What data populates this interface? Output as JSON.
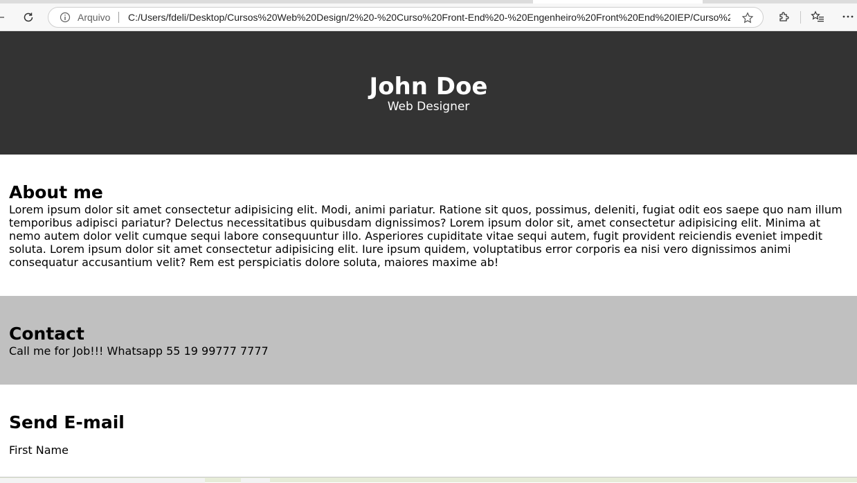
{
  "browser": {
    "site_label": "Arquivo",
    "url": "C:/Users/fdeli/Desktop/Cursos%20Web%20Design/2%20-%20Curso%20Front-End%20-%20Engenheiro%20Front%20End%20IEP/Curso%20..."
  },
  "header": {
    "name": "John Doe",
    "role": "Web Designer"
  },
  "about": {
    "title": "About me",
    "text": "Lorem ipsum dolor sit amet consectetur adipisicing elit. Modi, animi pariatur. Ratione sit quos, possimus, deleniti, fugiat odit eos saepe quo nam illum temporibus adipisci pariatur? Delectus necessitatibus quibusdam dignissimos? Lorem ipsum dolor sit, amet consectetur adipisicing elit. Minima at nemo autem dolor velit cumque sequi labore consequuntur illo. Asperiores cupiditate vitae sequi autem, fugit provident reiciendis eveniet impedit soluta. Lorem ipsum dolor sit amet consectetur adipisicing elit. Iure ipsum quidem, voluptatibus error corporis ea nisi vero dignissimos animi consequatur accusantium velit? Rem est perspiciatis dolore soluta, maiores maxime ab!"
  },
  "contact": {
    "title": "Contact",
    "text": "Call me for Job!!! Whatsapp 55 19 99777 7777"
  },
  "email_form": {
    "title": "Send E-mail",
    "first_name_label": "First Name"
  },
  "colors": {
    "header_bg": "#333333",
    "contact_bg": "#c0c0c0"
  },
  "icons": [
    "back-icon",
    "reload-icon",
    "info-icon",
    "star-icon",
    "extensions-icon",
    "favorites-icon",
    "more-icon"
  ]
}
